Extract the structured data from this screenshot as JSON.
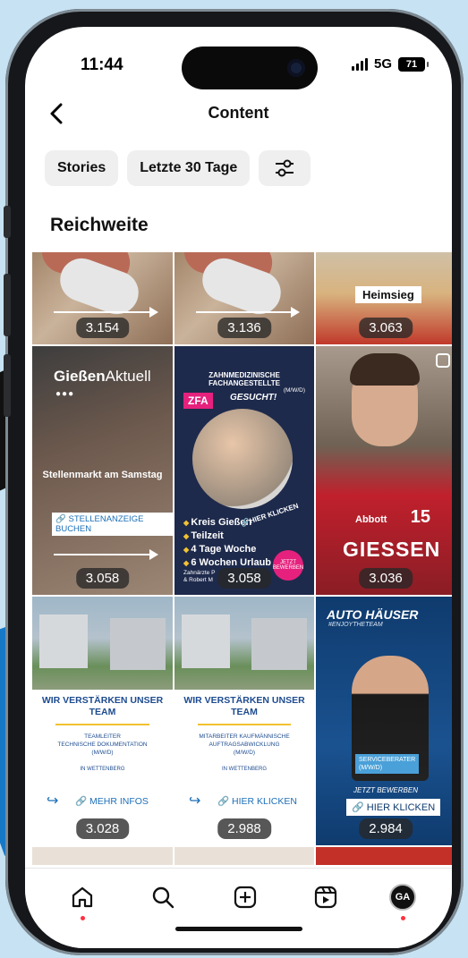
{
  "status": {
    "time": "11:44",
    "network": "5G",
    "battery": "71"
  },
  "header": {
    "title": "Content"
  },
  "filters": {
    "type": "Stories",
    "period": "Letzte 30 Tage"
  },
  "section": {
    "title": "Reichweite"
  },
  "posts": [
    {
      "reach": "3.154"
    },
    {
      "reach": "3.136"
    },
    {
      "reach": "3.063",
      "label": "Heimsieg"
    },
    {
      "reach": "3.058",
      "brand_a": "Gießen",
      "brand_b": "Aktuell",
      "text": "Stellenmarkt am Samstag",
      "link": "STELLENANZEIGE BUCHEN"
    },
    {
      "reach": "3.058",
      "headline": "ZAHNMEDIZINISCHE FACHANGESTELLTE",
      "mwd": "(M/W/D)",
      "badge": "ZFA",
      "gesucht": "GESUCHT!",
      "list": [
        "Kreis Gießen",
        "Teilzeit",
        "4 Tage Woche",
        "6 Wochen Urlaub"
      ],
      "hier": "HIER KLICKEN",
      "jetzt": "JETZT BEWERBEN",
      "footer": "Zahnärzte P\n& Robert M"
    },
    {
      "reach": "3.036",
      "sponsor": "Abbott",
      "number": "15",
      "name": "GIESSEN"
    },
    {
      "reach": "3.028",
      "headline": "WIR VERSTÄRKEN UNSER TEAM",
      "sub": "TEAMLEITER\nTECHNISCHE DOKUMENTATION\n(M/W/D)",
      "location": "IN WETTENBERG",
      "link": "MEHR INFOS"
    },
    {
      "reach": "2.988",
      "headline": "WIR VERSTÄRKEN UNSER TEAM",
      "sub": "MITARBEITER KAUFMÄNNISCHE\nAUFTRAGSABWICKLUNG\n(M/W/D)",
      "location": "IN WETTENBERG",
      "link": "HIER KLICKEN"
    },
    {
      "reach": "2.984",
      "brand": "AUTO HÄUSER",
      "tagline": "#ENJOYTHETEAM",
      "role": "SERVICEBERATER\n(M/W/D)",
      "cta_pre": "JETZT BEWERBEN",
      "cta": "HIER KLICKEN"
    }
  ],
  "tabs": [
    "home",
    "search",
    "create",
    "reels",
    "profile"
  ],
  "profile_initials": "GA"
}
